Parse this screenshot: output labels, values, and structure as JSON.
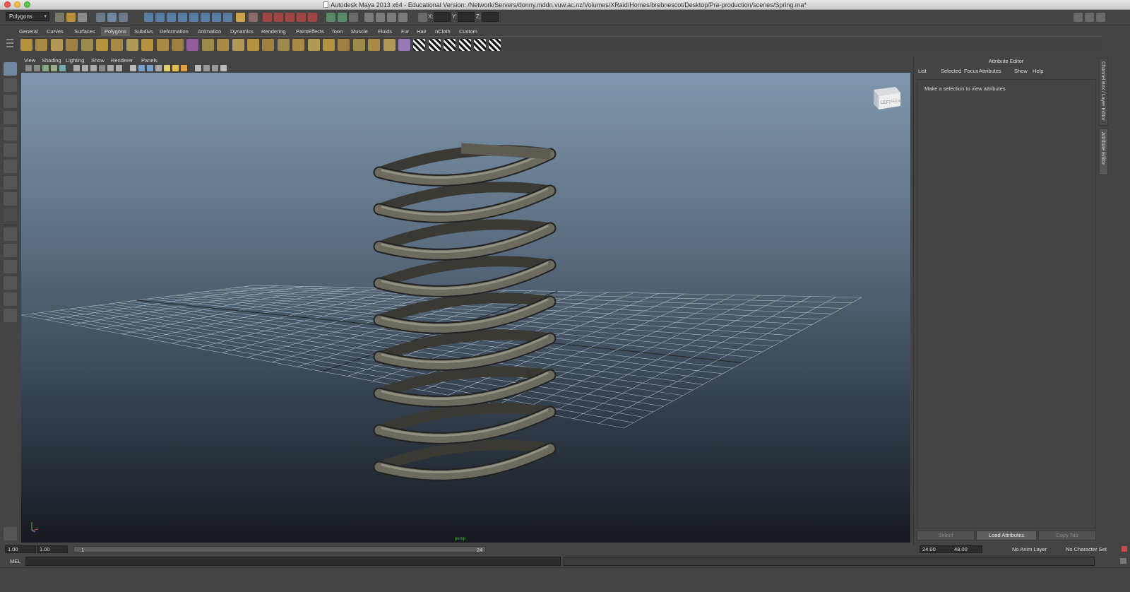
{
  "window": {
    "title": "Autodesk Maya 2013 x64 - Educational Version: /Network/Servers/donny.mddn.vuw.ac.nz/Volumes/XRaid/Homes/brebnescot/Desktop/Pre-production/scenes/Spring.ma*"
  },
  "status_line": {
    "menu_set": "Polygons",
    "x_label": "X:",
    "y_label": "Y:",
    "z_label": "Z:"
  },
  "shelf": {
    "tabs": [
      "General",
      "Curves",
      "Surfaces",
      "Polygons",
      "Subdivs",
      "Deformation",
      "Animation",
      "Dynamics",
      "Rendering",
      "PaintEffects",
      "Toon",
      "Muscle",
      "Fluids",
      "Fur",
      "Hair",
      "nCloth",
      "Custom"
    ],
    "active_tab": "Polygons"
  },
  "viewport": {
    "menu": [
      "View",
      "Shading",
      "Lighting",
      "Show",
      "Renderer",
      "Panels"
    ],
    "view_cube": {
      "left": "LEFT",
      "front": "FRONT"
    },
    "camera_label": "persp"
  },
  "attribute_editor": {
    "title": "Attribute Editor",
    "menu": [
      "List",
      "Selected",
      "Focus",
      "Attributes",
      "Show",
      "Help"
    ],
    "message": "Make a selection to view attributes",
    "buttons": {
      "select": "Select",
      "load": "Load Attributes",
      "copy": "Copy Tab"
    },
    "side_tabs": [
      "Channel Box / Layer Editor",
      "Attribute Editor"
    ]
  },
  "time": {
    "start": "1.00",
    "playback_start": "1.00",
    "slider_start": "1",
    "slider_end": "24",
    "playback_end": "24.00",
    "end": "48.00",
    "anim_layer": "No Anim Layer",
    "character_set": "No Character Set"
  },
  "command_line": {
    "label": "MEL"
  },
  "colors": {
    "accent_blue": "#6f87a0",
    "panel_bg": "#444444",
    "viewport_top": "#7f97ad",
    "viewport_bottom": "#161a1f"
  }
}
